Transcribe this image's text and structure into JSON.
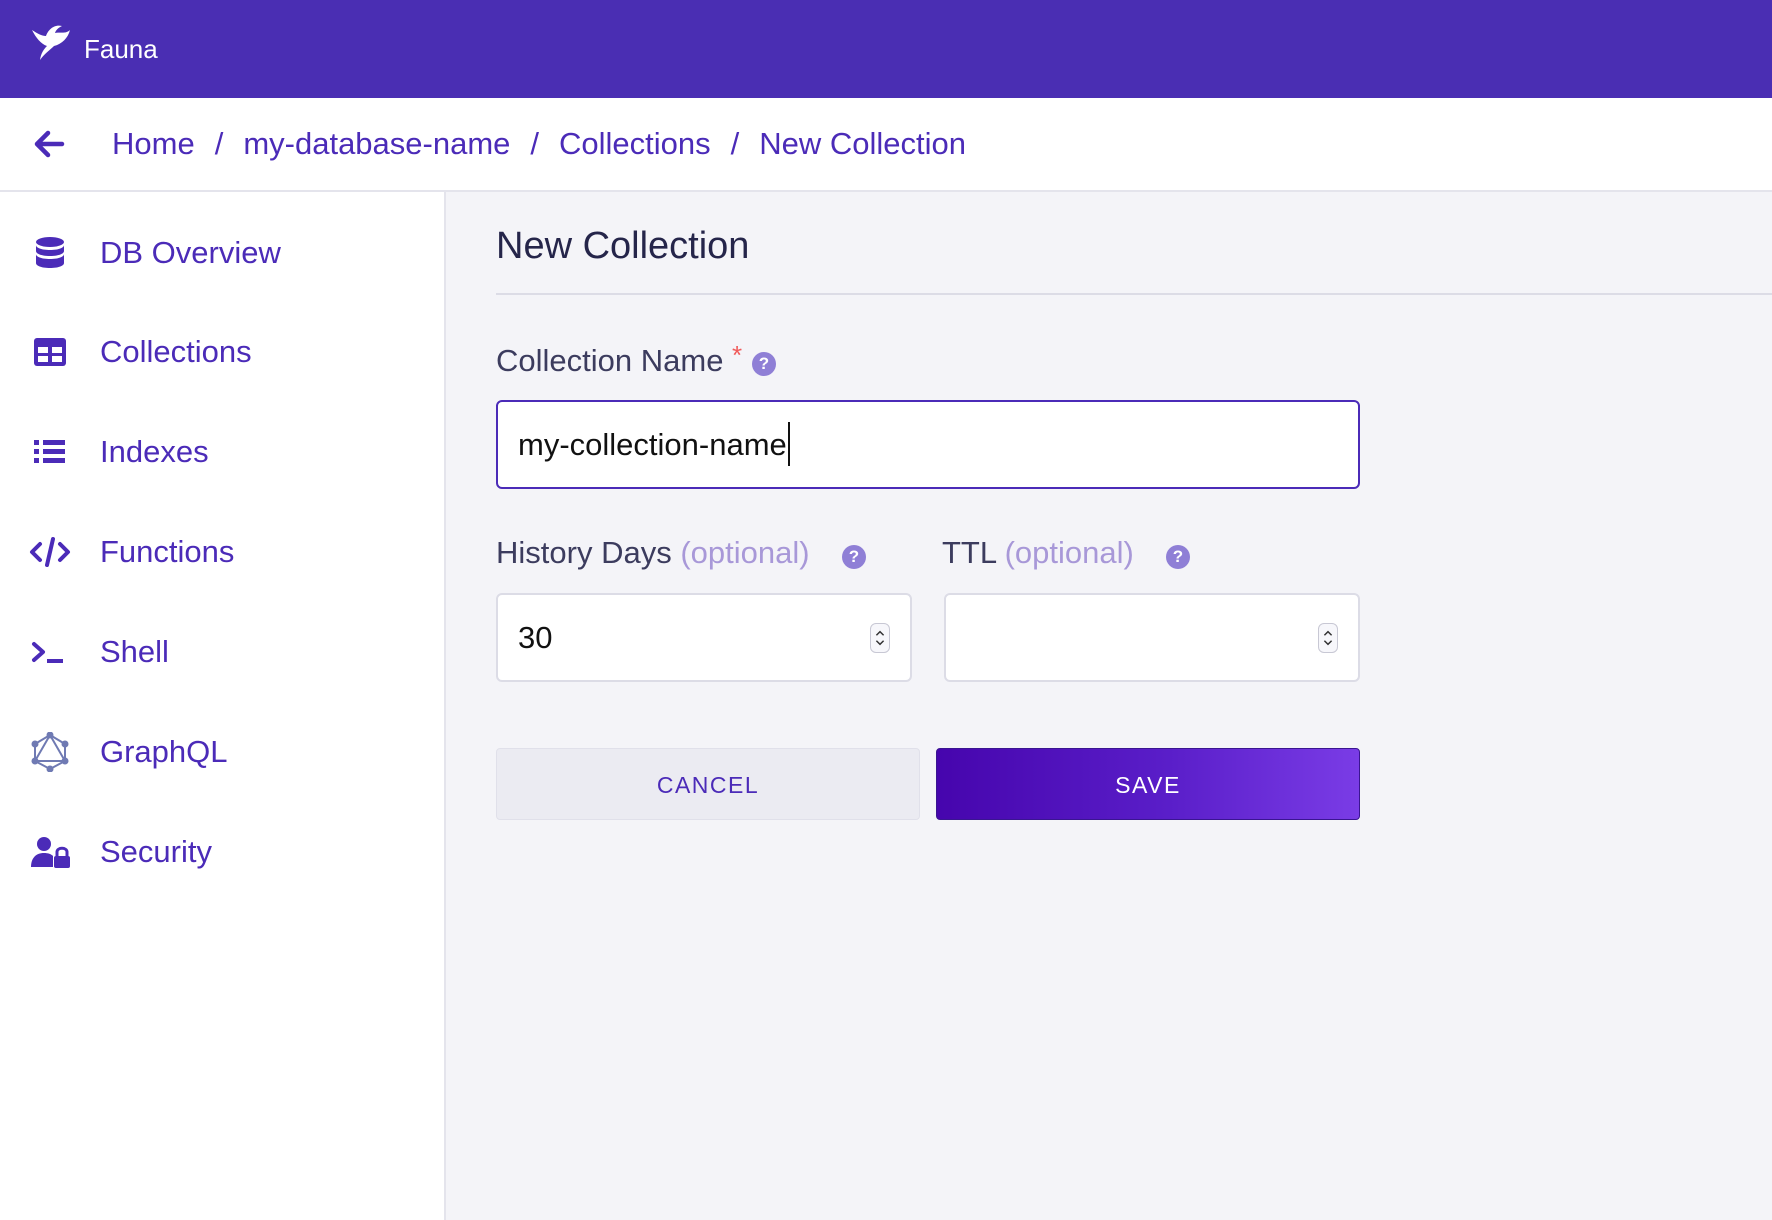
{
  "header": {
    "brand": "Fauna",
    "logo_icon": "fauna-bird-icon",
    "background": "#4a2eb3"
  },
  "breadcrumb": {
    "back_icon": "arrow-left-icon",
    "items": [
      "Home",
      "my-database-name",
      "Collections",
      "New Collection"
    ],
    "separator": "/"
  },
  "sidebar": {
    "items": [
      {
        "label": "DB Overview",
        "icon": "database-icon"
      },
      {
        "label": "Collections",
        "icon": "table-icon"
      },
      {
        "label": "Indexes",
        "icon": "list-icon"
      },
      {
        "label": "Functions",
        "icon": "code-icon"
      },
      {
        "label": "Shell",
        "icon": "terminal-icon"
      },
      {
        "label": "GraphQL",
        "icon": "graphql-icon"
      },
      {
        "label": "Security",
        "icon": "user-lock-icon"
      }
    ]
  },
  "form": {
    "title": "New Collection",
    "collection_name": {
      "label": "Collection Name",
      "required_marker": "*",
      "value": "my-collection-name"
    },
    "history_days": {
      "label": "History Days",
      "optional": "(optional)",
      "value": "30"
    },
    "ttl": {
      "label": "TTL",
      "optional": "(optional)",
      "value": ""
    },
    "help_glyph": "?",
    "cancel_label": "CANCEL",
    "save_label": "SAVE"
  },
  "colors": {
    "accent": "#4b2bb8",
    "required": "#f05a5a",
    "optional_text": "#a898d8",
    "save_gradient_start": "#4605ad",
    "save_gradient_end": "#7a3ce6"
  }
}
